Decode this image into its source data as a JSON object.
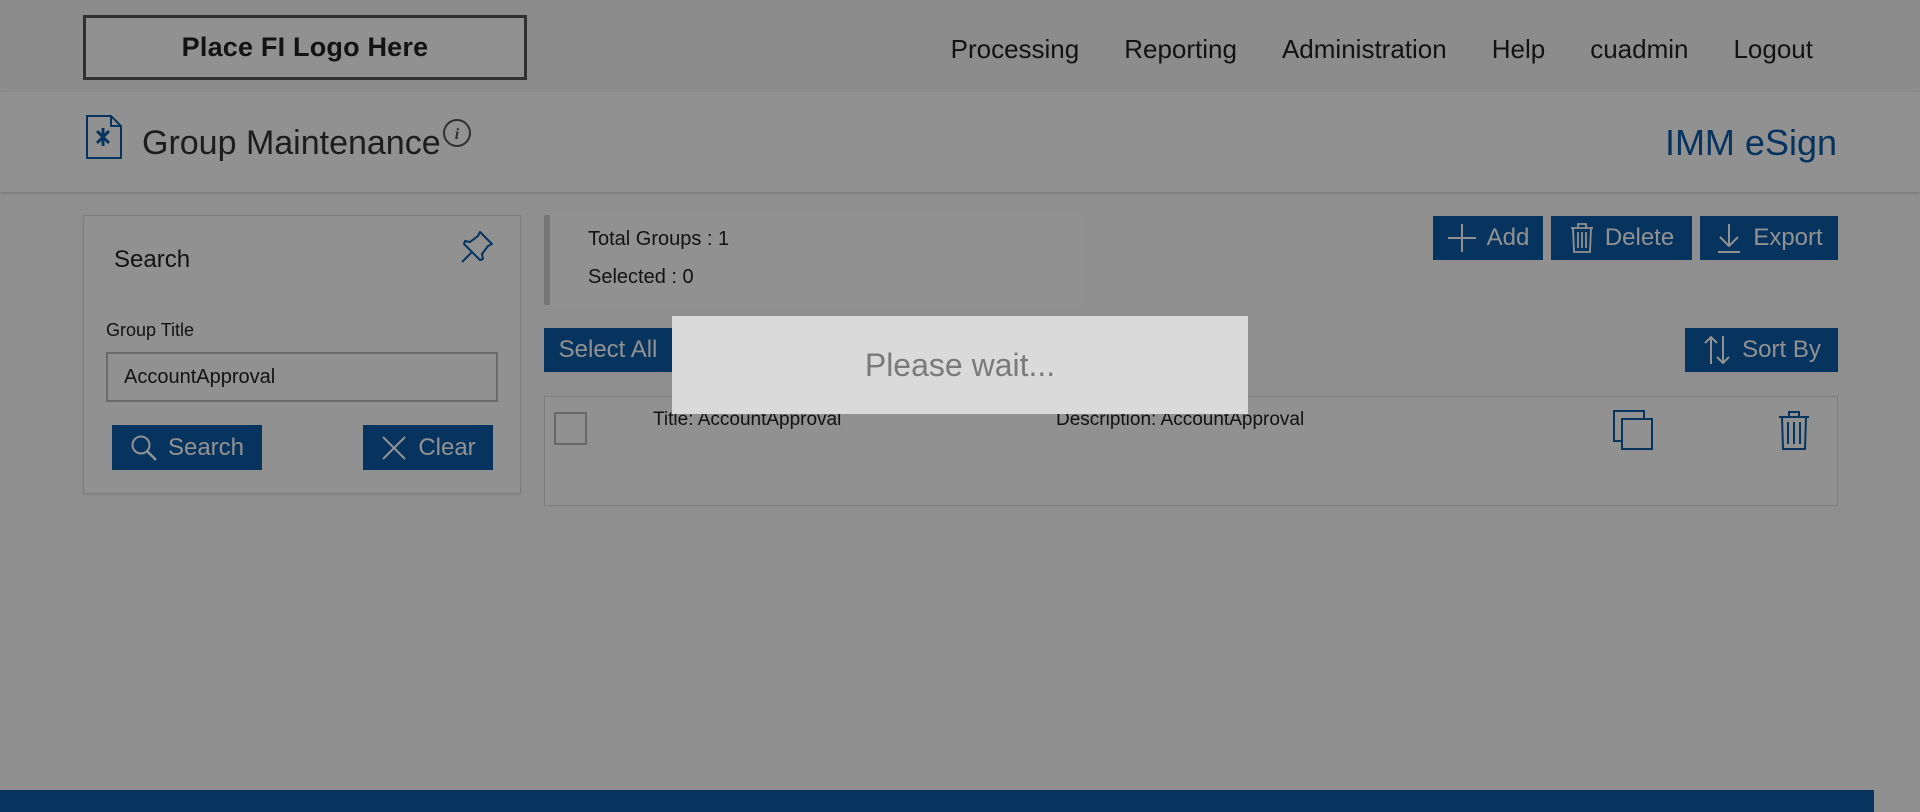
{
  "header": {
    "logo_text": "Place FI Logo Here",
    "nav": [
      "Processing",
      "Reporting",
      "Administration",
      "Help",
      "cuadmin",
      "Logout"
    ]
  },
  "page": {
    "title": "Group Maintenance",
    "product": "IMM eSign"
  },
  "search_panel": {
    "title": "Search",
    "field_label": "Group Title",
    "field_value": "AccountApproval",
    "search_button": "Search",
    "clear_button": "Clear"
  },
  "summary": {
    "total_label": "Total Groups : 1",
    "selected_label": "Selected : 0"
  },
  "toolbar": {
    "add": "Add",
    "delete": "Delete",
    "export": "Export",
    "select_all": "Select All",
    "sort_by": "Sort By"
  },
  "results": [
    {
      "title": "Title:  AccountApproval",
      "description": "Description:  AccountApproval"
    }
  ],
  "overlay": {
    "message": "Please wait..."
  },
  "colors": {
    "accent": "#0b5ca8",
    "overlay": "rgba(0,0,0,0.43)"
  }
}
